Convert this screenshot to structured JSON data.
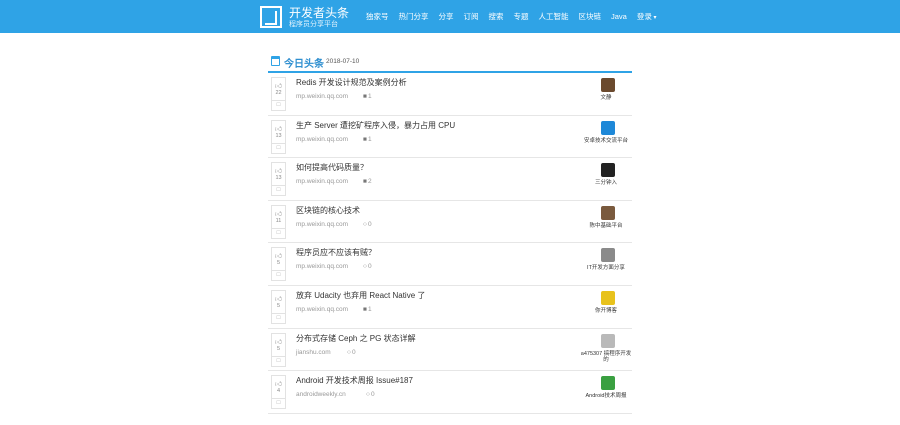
{
  "brand": {
    "title": "开发者头条",
    "subtitle": "程序员分享平台"
  },
  "nav": [
    "独家号",
    "热门分享",
    "分享",
    "订阅",
    "搜索",
    "专题",
    "人工智能",
    "区块链",
    "Java",
    "登录"
  ],
  "section": {
    "title": "今日头条",
    "date": "2018-07-10"
  },
  "items": [
    {
      "title": "Redis 开发设计规范及案例分析",
      "source": "mp.weixin.qq.com",
      "comments": "1",
      "votes": "22",
      "author": "文静",
      "avatar_color": "#6b4a2e",
      "comment_style": "filled"
    },
    {
      "title": "生产 Server 遭挖矿程序入侵，暴力占用 CPU",
      "source": "mp.weixin.qq.com",
      "comments": "1",
      "votes": "13",
      "author": "安卓技术交流平台",
      "avatar_color": "#1e88d8",
      "comment_style": "filled"
    },
    {
      "title": "如何提高代码质量？",
      "source": "mp.weixin.qq.com",
      "comments": "2",
      "votes": "13",
      "author": "三分钟入",
      "avatar_color": "#222222",
      "comment_style": "filled"
    },
    {
      "title": "区块链的核心技术",
      "source": "mp.weixin.qq.com",
      "comments": "0",
      "votes": "11",
      "author": "陈中基础平台",
      "avatar_color": "#7a5a3e",
      "comment_style": "outline"
    },
    {
      "title": "程序员应不应该有贼？",
      "source": "mp.weixin.qq.com",
      "comments": "0",
      "votes": "5",
      "author": "IT开发方面分享",
      "avatar_color": "#8a8a8a",
      "comment_style": "outline"
    },
    {
      "title": "放弃 Udacity 也弃用 React Native 了",
      "source": "mp.weixin.qq.com",
      "comments": "1",
      "votes": "5",
      "author": "你开博客",
      "avatar_color": "#e8c21c",
      "comment_style": "filled"
    },
    {
      "title": "分布式存储 Ceph 之 PG 状态详解",
      "source": "jianshu.com",
      "comments": "0",
      "votes": "5",
      "author": "a475307 搞程序开发的",
      "avatar_color": "#b9b9b9",
      "comment_style": "outline"
    },
    {
      "title": "Android 开发技术周报 Issue#187",
      "source": "androidweekly.cn",
      "comments": "0",
      "votes": "4",
      "author": "Android技术周报",
      "avatar_color": "#3aa041",
      "comment_style": "outline"
    }
  ]
}
